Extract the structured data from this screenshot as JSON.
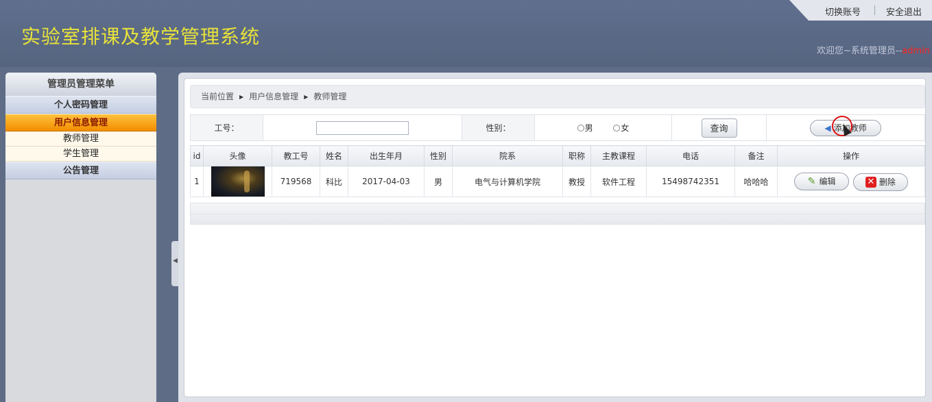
{
  "app": {
    "title": "实验室排课及教学管理系统"
  },
  "top_links": {
    "switch_account": "切换账号",
    "logout": "安全退出"
  },
  "welcome": {
    "prefix": "欢迎您~系统管理员--",
    "user": "admin"
  },
  "sidebar": {
    "header": "管理员管理菜单",
    "menus": [
      {
        "label": "个人密码管理"
      },
      {
        "label": "用户信息管理",
        "active": true,
        "items": [
          "教师管理",
          "学生管理"
        ]
      },
      {
        "label": "公告管理"
      }
    ]
  },
  "breadcrumb": [
    "当前位置",
    "用户信息管理",
    "教师管理"
  ],
  "search": {
    "id_label": "工号：",
    "id_value": "",
    "gender_label": "性别：",
    "gender_options": [
      "男",
      "女"
    ],
    "query_button": "查询",
    "add_button": "添加教师"
  },
  "table": {
    "columns": [
      "id",
      "头像",
      "教工号",
      "姓名",
      "出生年月",
      "性别",
      "院系",
      "职称",
      "主教课程",
      "电话",
      "备注",
      "操作"
    ],
    "rows": [
      {
        "id": "1",
        "staff_no": "719568",
        "name": "科比",
        "birth": "2017-04-03",
        "gender": "男",
        "dept": "电气与计算机学院",
        "title": "教授",
        "course": "软件工程",
        "phone": "15498742351",
        "note": "哈哈哈",
        "edit": "编辑",
        "delete": "删除"
      }
    ]
  },
  "colors": {
    "title_yellow": "#e8e23a",
    "header_bg": "#5f6f8d",
    "active_menu": "#f28d00",
    "admin_red": "#ff2222"
  }
}
